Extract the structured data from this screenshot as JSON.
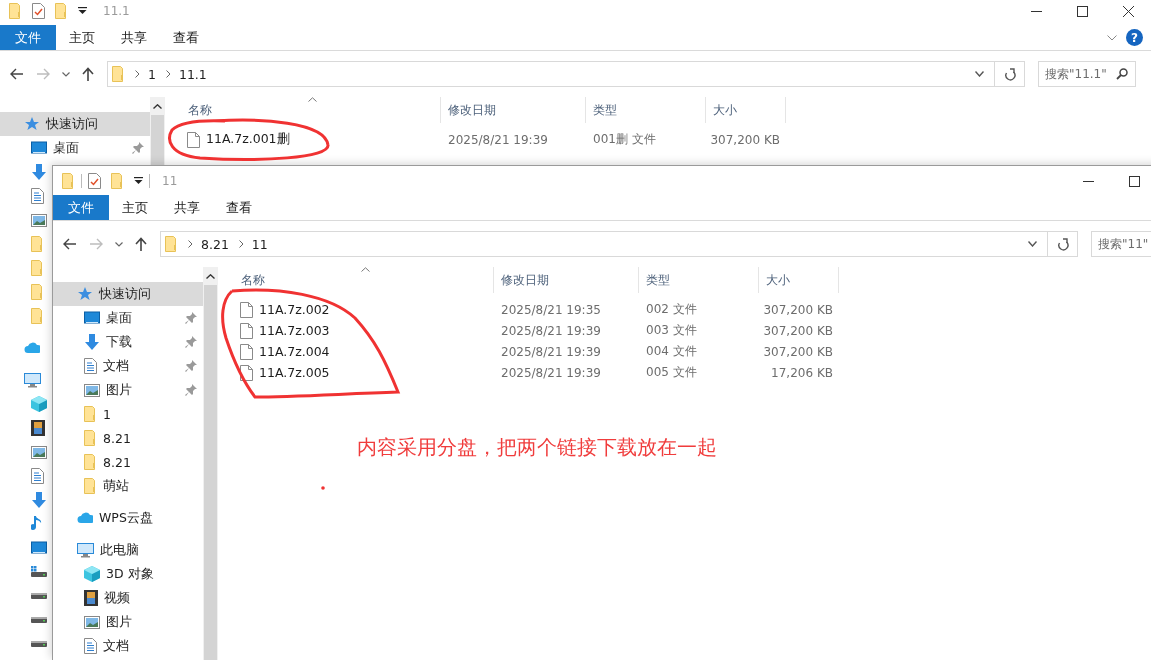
{
  "back_window": {
    "title": "11.1",
    "window_controls": [
      {
        "kind": "minimize"
      },
      {
        "kind": "maximize"
      },
      {
        "kind": "close"
      }
    ],
    "help": {
      "glyph": "?"
    },
    "ribbon_tabs": [
      {
        "label": "文件",
        "selected": true
      },
      {
        "label": "主页",
        "selected": false
      },
      {
        "label": "共享",
        "selected": false
      },
      {
        "label": "查看",
        "selected": false
      }
    ],
    "forward_disabled": true,
    "path": [
      "1",
      "11.1"
    ],
    "search": {
      "placeholder": "搜索\"11.1\""
    },
    "sidebar": [
      {
        "label": "快速访问",
        "kind": "star",
        "selected": true,
        "children": [
          {
            "label": "桌面",
            "kind": "desktop",
            "pinned": true,
            "selected": false
          },
          {
            "kind": "download",
            "selected": false
          },
          {
            "kind": "doc",
            "selected": false
          },
          {
            "kind": "picture",
            "selected": false
          },
          {
            "kind": "folder",
            "selected": false
          },
          {
            "kind": "folder",
            "selected": false
          },
          {
            "kind": "folder",
            "selected": false
          },
          {
            "kind": "folder",
            "selected": false
          }
        ]
      },
      {
        "kind": "cloud",
        "selected": false
      },
      {
        "kind": "pc",
        "selected": false,
        "children": [
          {
            "kind": "cube",
            "selected": false
          },
          {
            "kind": "film",
            "selected": false
          },
          {
            "kind": "picture",
            "selected": false
          },
          {
            "kind": "doc",
            "selected": false
          },
          {
            "kind": "download",
            "selected": false
          },
          {
            "kind": "music",
            "selected": false
          },
          {
            "kind": "desktop",
            "selected": false
          },
          {
            "kind": "drive-win",
            "selected": false
          },
          {
            "kind": "drive",
            "selected": false
          },
          {
            "kind": "drive",
            "selected": false
          },
          {
            "kind": "drive",
            "selected": false
          }
        ]
      }
    ],
    "columns": [
      "名称",
      "修改日期",
      "类型",
      "大小"
    ],
    "rows": [
      {
        "name": "11A.7z.001删",
        "modified": "2025/8/21 19:39",
        "type": "001删 文件",
        "size": "307,200 KB"
      }
    ]
  },
  "front_window": {
    "title": "11",
    "window_controls": [
      {
        "kind": "minimize"
      },
      {
        "kind": "maximize"
      }
    ],
    "ribbon_tabs": [
      {
        "label": "文件",
        "selected": true
      },
      {
        "label": "主页",
        "selected": false
      },
      {
        "label": "共享",
        "selected": false
      },
      {
        "label": "查看",
        "selected": false
      }
    ],
    "forward_disabled": true,
    "path": [
      "8.21",
      "11"
    ],
    "search": {
      "placeholder": "搜索\"11\""
    },
    "sidebar": [
      {
        "label": "快速访问",
        "kind": "star",
        "selected": true,
        "children": [
          {
            "label": "桌面",
            "kind": "desktop",
            "pinned": true,
            "selected": false
          },
          {
            "label": "下载",
            "kind": "download",
            "pinned": true,
            "selected": false
          },
          {
            "label": "文档",
            "kind": "doc",
            "pinned": true,
            "selected": false
          },
          {
            "label": "图片",
            "kind": "picture",
            "pinned": true,
            "selected": false
          },
          {
            "label": "1",
            "kind": "folder",
            "pinned": false,
            "selected": false
          },
          {
            "label": "8.21",
            "kind": "folder",
            "pinned": false,
            "selected": false
          },
          {
            "label": "8.21",
            "kind": "folder",
            "pinned": false,
            "selected": false
          },
          {
            "label": "萌站",
            "kind": "folder",
            "pinned": false,
            "selected": false
          }
        ]
      },
      {
        "label": "WPS云盘",
        "kind": "cloud",
        "selected": false
      },
      {
        "label": "此电脑",
        "kind": "pc",
        "selected": false,
        "children": [
          {
            "label": "3D 对象",
            "kind": "cube",
            "selected": false
          },
          {
            "label": "视频",
            "kind": "film",
            "selected": false
          },
          {
            "label": "图片",
            "kind": "picture",
            "selected": false
          },
          {
            "label": "文档",
            "kind": "doc",
            "selected": false
          }
        ]
      }
    ],
    "columns": [
      "名称",
      "修改日期",
      "类型",
      "大小"
    ],
    "rows": [
      {
        "name": "11A.7z.002",
        "modified": "2025/8/21 19:35",
        "type": "002 文件",
        "size": "307,200 KB"
      },
      {
        "name": "11A.7z.003",
        "modified": "2025/8/21 19:39",
        "type": "003 文件",
        "size": "307,200 KB"
      },
      {
        "name": "11A.7z.004",
        "modified": "2025/8/21 19:39",
        "type": "004 文件",
        "size": "307,200 KB"
      },
      {
        "name": "11A.7z.005",
        "modified": "2025/8/21 19:39",
        "type": "005 文件",
        "size": "17,206 KB"
      }
    ]
  },
  "annotation": {
    "text": "内容采用分盘，把两个链接下载放在一起"
  }
}
